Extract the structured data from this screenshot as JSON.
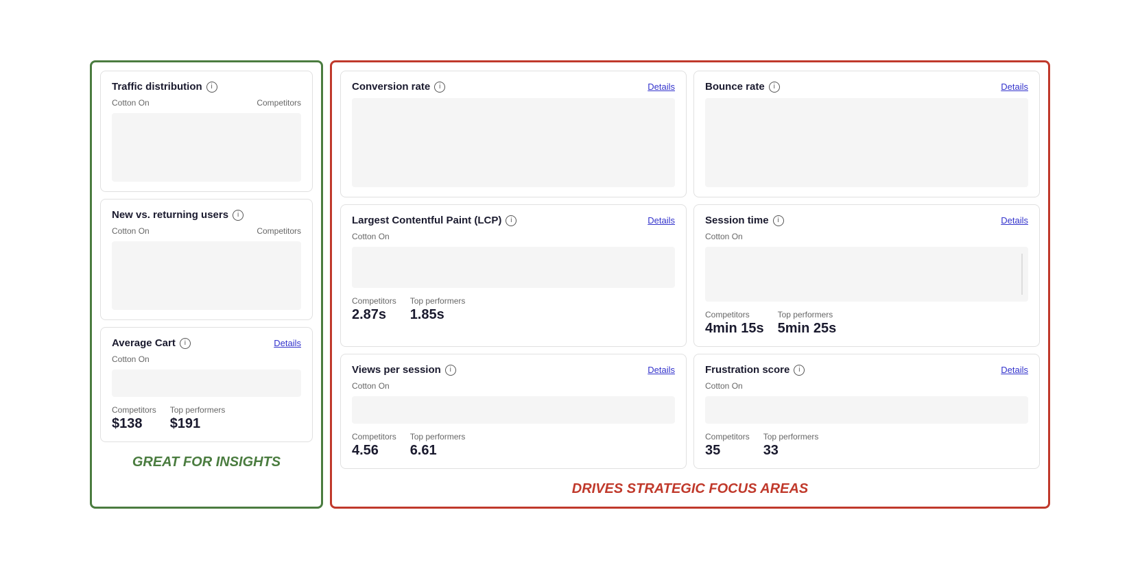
{
  "sections": {
    "green": {
      "label": "GREAT FOR INSIGHTS",
      "cards": [
        {
          "id": "traffic-distribution",
          "title": "Traffic distribution",
          "has_info": true,
          "has_details": false,
          "labels": [
            "Cotton On",
            "Competitors"
          ],
          "chart_type": "traffic"
        },
        {
          "id": "new-vs-returning",
          "title": "New vs. returning users",
          "has_info": true,
          "has_details": false,
          "labels": [
            "Cotton On",
            "Competitors"
          ],
          "chart_type": "new-vs-returning"
        },
        {
          "id": "average-cart",
          "title": "Average Cart",
          "has_info": true,
          "has_details": true,
          "details_label": "Details",
          "cotton_on_label": "Cotton On",
          "competitors_label": "Competitors",
          "competitors_value": "$138",
          "top_performers_label": "Top performers",
          "top_performers_value": "$191",
          "chart_type": "average-cart"
        }
      ]
    },
    "red": {
      "label": "DRIVES STRATEGIC FOCUS AREAS",
      "cards": [
        {
          "id": "conversion-rate",
          "title": "Conversion rate",
          "has_info": true,
          "has_details": true,
          "details_label": "Details",
          "chart_type": "conversion"
        },
        {
          "id": "bounce-rate",
          "title": "Bounce rate",
          "has_info": true,
          "has_details": true,
          "details_label": "Details",
          "chart_type": "bounce"
        },
        {
          "id": "lcp",
          "title": "Largest Contentful Paint (LCP)",
          "has_info": true,
          "has_details": true,
          "details_label": "Details",
          "cotton_on_label": "Cotton On",
          "competitors_label": "Competitors",
          "competitors_value": "2.87s",
          "top_performers_label": "Top performers",
          "top_performers_value": "1.85s",
          "chart_type": "lcp"
        },
        {
          "id": "session-time",
          "title": "Session time",
          "has_info": true,
          "has_details": true,
          "details_label": "Details",
          "cotton_on_label": "Cotton On",
          "competitors_label": "Competitors",
          "competitors_value": "4min 15s",
          "top_performers_label": "Top performers",
          "top_performers_value": "5min 25s",
          "chart_type": "session"
        },
        {
          "id": "views-per-session",
          "title": "Views per session",
          "has_info": true,
          "has_details": true,
          "details_label": "Details",
          "cotton_on_label": "Cotton On",
          "competitors_label": "Competitors",
          "competitors_value": "4.56",
          "top_performers_label": "Top performers",
          "top_performers_value": "6.61",
          "chart_type": "views"
        },
        {
          "id": "frustration-score",
          "title": "Frustration score",
          "has_info": true,
          "has_details": true,
          "details_label": "Details",
          "cotton_on_label": "Cotton On",
          "competitors_label": "Competitors",
          "competitors_value": "35",
          "top_performers_label": "Top performers",
          "top_performers_value": "33",
          "chart_type": "frustration"
        }
      ]
    }
  }
}
